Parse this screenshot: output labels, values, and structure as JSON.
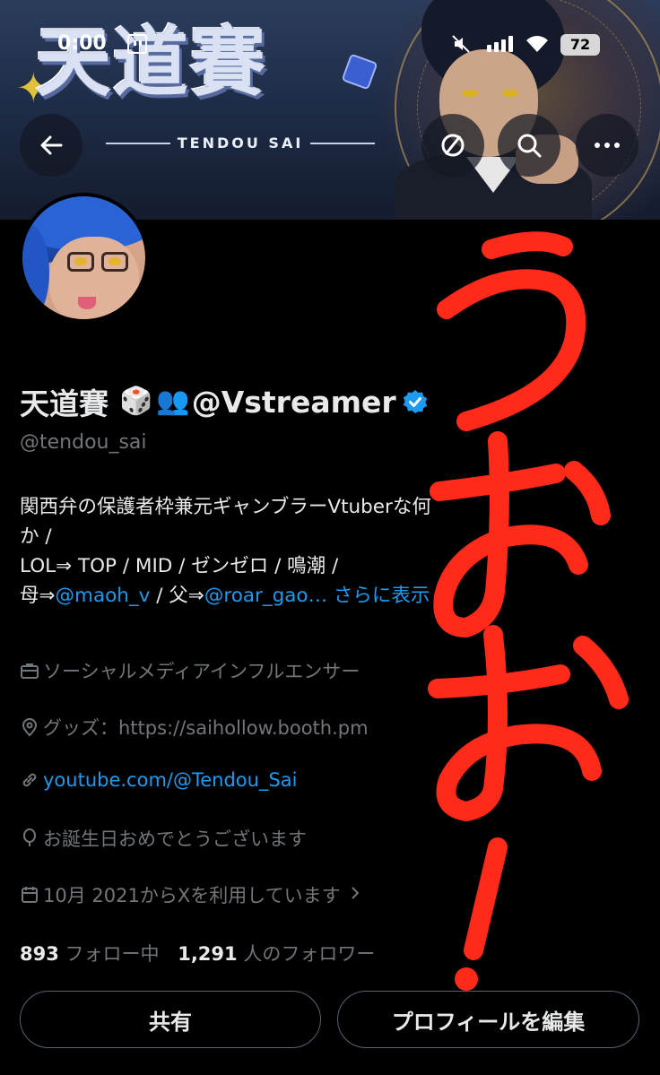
{
  "status_bar": {
    "time": "0:00",
    "battery": "72"
  },
  "banner": {
    "logo_title": "天道賽",
    "logo_subtitle": "TENDOU SAI"
  },
  "profile": {
    "display_name": "天道賽",
    "emoji_dice": "🎲",
    "emoji_people": "👥",
    "name_suffix": "@Vstreamer",
    "handle": "@tendou_sai",
    "bio": {
      "line1": "関西弁の保護者枠兼元ギャンブラーVtub",
      "line1_hidden": "erな何",
      "line2": "か /",
      "line3": "LOL⇒ TOP / MID / ゼンゼロ / 鳴潮 /",
      "line4_prefix": "母⇒",
      "mention1": "@maoh_v",
      "line4_mid": " / 父⇒",
      "mention2": "@roar_gao…",
      "show_more": " さらに表示"
    },
    "category": "ソーシャルメディアインフルエンサー",
    "location": "グッズ：https://saihollow.booth.pm",
    "website": "youtube.com/@Tendou_Sai",
    "birthday": "お誕生日おめでとうございます",
    "joined": "10月 2021からXを利用しています",
    "following_count": "893",
    "following_label": " フォロー中",
    "followers_count": "1,291",
    "followers_label": " 人のフォロワー"
  },
  "buttons": {
    "share": "共有",
    "edit_profile": "プロフィールを編集"
  },
  "overlay_annotation": "うおお！",
  "colors": {
    "link": "#1d9bf0",
    "annotation": "#ff2a1a",
    "muted_text": "#71767b"
  },
  "icons": [
    "back-arrow-icon",
    "no-entry-icon",
    "search-icon",
    "more-icon",
    "briefcase-icon",
    "location-pin-icon",
    "link-icon",
    "balloon-icon",
    "calendar-icon",
    "chevron-right-icon",
    "verified-badge-icon"
  ]
}
